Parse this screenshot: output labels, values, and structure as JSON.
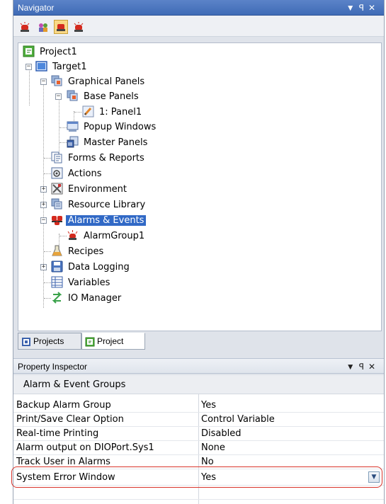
{
  "navigator": {
    "title": "Navigator",
    "controls": "▾ ᵖ ✕"
  },
  "tree": {
    "project": "Project1",
    "target": "Target1",
    "graphical_panels": "Graphical Panels",
    "base_panels": "Base Panels",
    "panel1": "1: Panel1",
    "popup_windows": "Popup Windows",
    "master_panels": "Master Panels",
    "forms_reports": "Forms & Reports",
    "actions": "Actions",
    "environment": "Environment",
    "resource_library": "Resource Library",
    "alarms_events": "Alarms & Events",
    "alarm_group1": "AlarmGroup1",
    "recipes": "Recipes",
    "data_logging": "Data Logging",
    "variables": "Variables",
    "io_manager": "IO Manager"
  },
  "tabs": {
    "projects": "Projects",
    "project": "Project"
  },
  "inspector": {
    "title": "Property Inspector",
    "group": "Alarm & Event Groups",
    "rows": [
      {
        "key": "Backup Alarm Group",
        "value": "Yes"
      },
      {
        "key": "Print/Save Clear Option",
        "value": "Control Variable"
      },
      {
        "key": "Real-time Printing",
        "value": "Disabled"
      },
      {
        "key": "Alarm output on DIOPort.Sys1",
        "value": "None"
      },
      {
        "key": "Track User in Alarms",
        "value": "No"
      },
      {
        "key": "System Error Window",
        "value": "Yes"
      }
    ]
  },
  "colors": {
    "title_blue": "#3f6bb6",
    "selection": "#3169c6",
    "highlight_ring": "#d9342b"
  }
}
